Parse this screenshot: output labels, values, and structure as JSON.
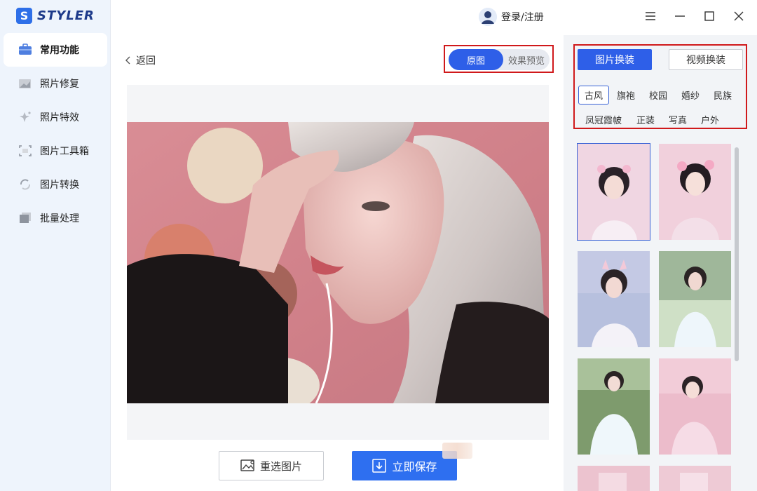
{
  "app": {
    "brand_name": "STYLER",
    "brand_letter": "S",
    "accent": "#2e5fe8"
  },
  "sidebar": {
    "items": [
      {
        "label": "常用功能",
        "icon": "toolbox-icon",
        "active": true
      },
      {
        "label": "照片修复",
        "icon": "photo-repair-icon",
        "active": false
      },
      {
        "label": "照片特效",
        "icon": "sparkle-icon",
        "active": false
      },
      {
        "label": "图片工具箱",
        "icon": "crop-frame-icon",
        "active": false
      },
      {
        "label": "图片转换",
        "icon": "convert-icon",
        "active": false
      },
      {
        "label": "批量处理",
        "icon": "batch-icon",
        "active": false
      }
    ]
  },
  "header": {
    "login_label": "登录/注册",
    "window_controls": [
      "menu-icon",
      "minimize-icon",
      "maximize-icon",
      "close-icon"
    ]
  },
  "main": {
    "back_label": "返回",
    "view_toggle": {
      "original_label": "原图",
      "preview_label": "效果预览",
      "selected": "原图"
    },
    "reselect_label": "重选图片",
    "save_label": "立即保存"
  },
  "right_panel": {
    "tabs": [
      {
        "label": "图片换装",
        "selected": true
      },
      {
        "label": "视频换装",
        "selected": false
      }
    ],
    "categories_row1": [
      "古风",
      "旗袍",
      "校园",
      "婚纱",
      "民族"
    ],
    "categories_row2": [
      "凤冠霞帔",
      "正装",
      "写真",
      "户外"
    ],
    "selected_category": "古风",
    "thumbnails_count": 8
  }
}
